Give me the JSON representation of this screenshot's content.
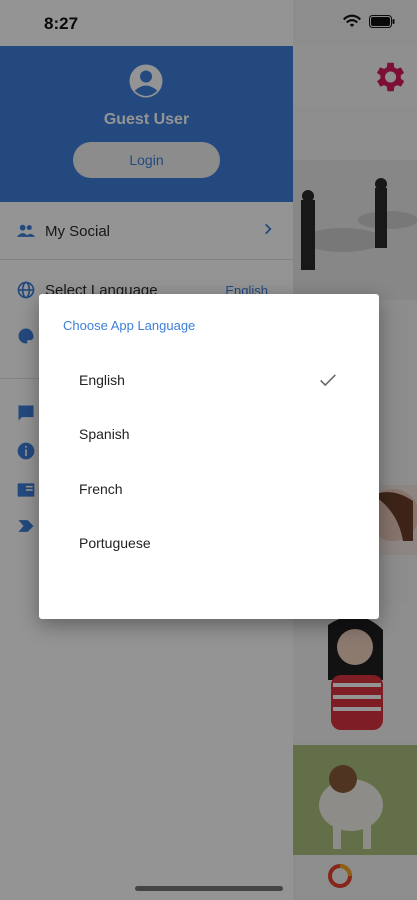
{
  "status_bar": {
    "time": "8:27"
  },
  "drawer": {
    "user_name": "Guest User",
    "login_label": "Login",
    "menu": {
      "my_social": "My Social",
      "select_language": "Select Language",
      "selected_language": "English"
    }
  },
  "dialog": {
    "title": "Choose App Language",
    "options": [
      "English",
      "Spanish",
      "French",
      "Portuguese"
    ],
    "selected": "English"
  },
  "colors": {
    "accent": "#3d7fdb",
    "gear": "#d81b60"
  },
  "icons": [
    "person-circle-icon",
    "people-icon",
    "chevron-right-icon",
    "globe-icon",
    "palette-icon",
    "feedback-icon",
    "info-icon",
    "book-icon",
    "label-icon",
    "gear-icon",
    "checkmark-icon",
    "wifi-icon",
    "battery-icon"
  ]
}
